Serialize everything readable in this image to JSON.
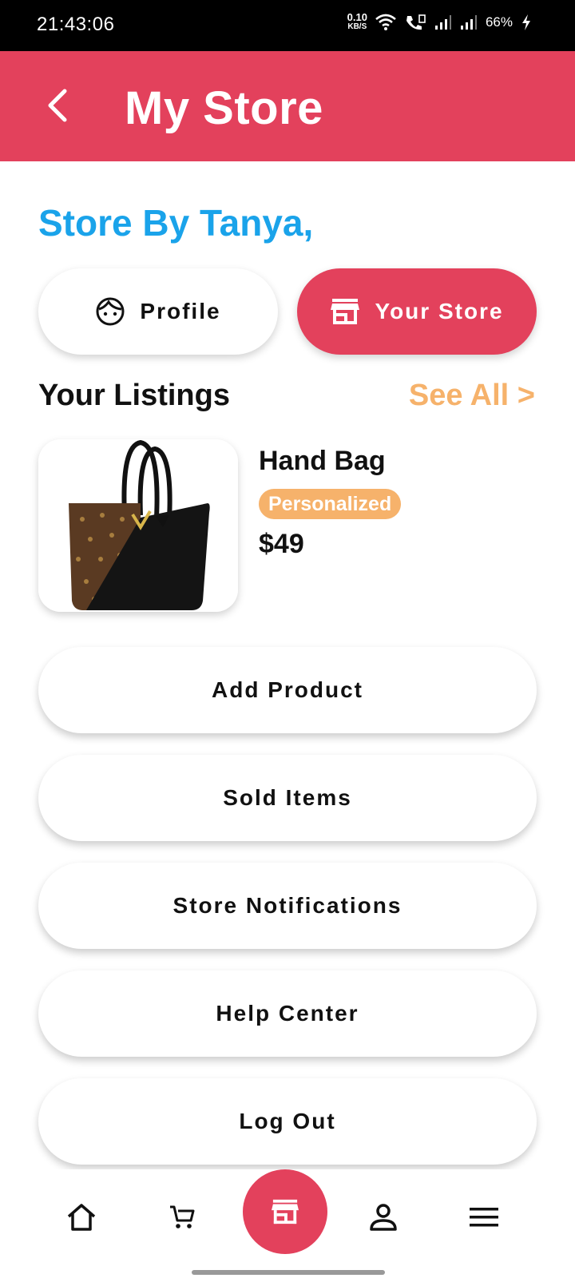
{
  "status_bar": {
    "time": "21:43:06",
    "net_speed_value": "0.10",
    "net_speed_unit": "KB/S",
    "battery": "66%"
  },
  "app_bar": {
    "title": "My Store",
    "back_icon": "chevron-left-icon"
  },
  "greeting": "Store By Tanya,",
  "tabs": [
    {
      "label": "Profile",
      "icon": "face-icon",
      "active": false
    },
    {
      "label": "Your Store",
      "icon": "store-icon",
      "active": true
    }
  ],
  "listings": {
    "title": "Your Listings",
    "see_all": "See All >",
    "items": [
      {
        "name": "Hand Bag",
        "badge": "Personalized",
        "price": "$49"
      }
    ]
  },
  "menu": [
    {
      "label": "Add Product"
    },
    {
      "label": "Sold Items"
    },
    {
      "label": "Store Notifications"
    },
    {
      "label": "Help Center"
    },
    {
      "label": "Log Out"
    }
  ],
  "bottom_nav": [
    {
      "icon": "home-icon"
    },
    {
      "icon": "cart-icon"
    },
    {
      "icon": "store-icon"
    },
    {
      "icon": "person-icon"
    },
    {
      "icon": "menu-icon"
    }
  ],
  "colors": {
    "primary": "#e3415c",
    "greeting": "#1aa3ea",
    "accent": "#f6b26b"
  }
}
